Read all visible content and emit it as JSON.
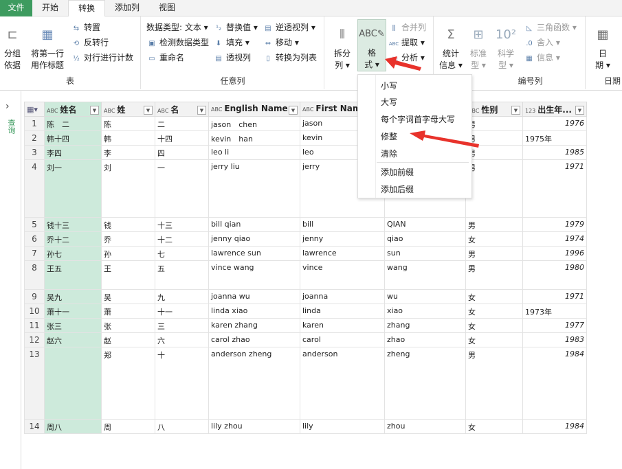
{
  "tabs": [
    "文件",
    "开始",
    "转换",
    "添加列",
    "视图"
  ],
  "ribbon": {
    "table_group": {
      "label": "表",
      "group_by": "分组\n依据",
      "use_first_row": "将第一行\n用作标题",
      "transpose": "转置",
      "reverse_rows": "反转行",
      "count_rows": "对行进行计数"
    },
    "any_column_group": {
      "label": "任意列",
      "data_type": "数据类型: 文本",
      "detect_type": "检测数据类型",
      "rename": "重命名",
      "replace_values": "替换值",
      "fill": "填充",
      "pivot": "透视列",
      "unpivot": "逆透视列",
      "move": "移动",
      "to_list": "转换为列表"
    },
    "text_group": {
      "split": "拆分\n列",
      "format": "格\n式",
      "merge": "合并列",
      "extract": "提取",
      "parse": "分析"
    },
    "number_group": {
      "label": "编号列",
      "stats": "统计\n信息",
      "standard": "标准\n型",
      "scientific": "科学\n型",
      "trig": "三角函数",
      "round": "舍入",
      "info": "信息"
    },
    "date_group": {
      "label": "日期",
      "date": "日\n期"
    }
  },
  "sidebar": {
    "label": "查询"
  },
  "format_menu": [
    "小写",
    "大写",
    "每个字词首字母大写",
    "修整",
    "清除",
    "添加前缀",
    "添加后缀"
  ],
  "table": {
    "columns": [
      {
        "type": "ABC",
        "name": "姓名"
      },
      {
        "type": "ABC",
        "name": "姓"
      },
      {
        "type": "ABC",
        "name": "名"
      },
      {
        "type": "ABC",
        "name": "English Name"
      },
      {
        "type": "ABC",
        "name": "First Name"
      },
      {
        "type": "",
        "name": ""
      },
      {
        "type": "ABC",
        "name": "性别"
      },
      {
        "type": "ABC123",
        "name": "出生年..."
      }
    ],
    "rows": [
      [
        "1",
        "陈　二",
        "陈",
        "二",
        "jason　chen",
        "jason",
        "",
        "男",
        1976
      ],
      [
        "2",
        "韩十四",
        "韩",
        "十四",
        "kevin　han",
        "kevin",
        "",
        "男",
        "1975年"
      ],
      [
        "3",
        "李四",
        "李",
        "四",
        "leo li",
        "leo",
        "",
        "男",
        1985
      ],
      [
        "4",
        "刘一",
        "刘",
        "一",
        "jerry liu",
        "jerry",
        "",
        "男",
        1971
      ],
      [
        "5",
        "钱十三",
        "钱",
        "十三",
        "bill qian",
        "bill",
        "QIAN",
        "男",
        1979
      ],
      [
        "6",
        "乔十二",
        "乔",
        "十二",
        "jenny qiao",
        "jenny",
        "qiao",
        "女",
        1974
      ],
      [
        "7",
        "孙七",
        "孙",
        "七",
        "lawrence sun",
        "lawrence",
        "sun",
        "男",
        1996
      ],
      [
        "8",
        "王五",
        "王",
        "五",
        "vince wang",
        "vince",
        "wang",
        "男",
        1980
      ],
      [
        "9",
        "吴九",
        "吴",
        "九",
        "joanna wu",
        "joanna",
        "wu",
        "女",
        1971
      ],
      [
        "10",
        "萧十一",
        "萧",
        "十一",
        "linda xiao",
        "linda",
        "xiao",
        "女",
        "1973年"
      ],
      [
        "11",
        "张三",
        "张",
        "三",
        "karen zhang",
        "karen",
        "zhang",
        "女",
        1977
      ],
      [
        "12",
        "赵六",
        "赵",
        "六",
        "carol zhao",
        "carol",
        "zhao",
        "女",
        1983
      ],
      [
        "13",
        "",
        "郑",
        "十",
        "anderson zheng",
        "anderson",
        "zheng",
        "男",
        1984
      ],
      [
        "14",
        "周八",
        "周",
        "八",
        "lily zhou",
        "lily",
        "zhou",
        "女",
        1984
      ]
    ]
  },
  "colors": {
    "accent": "#3d9b5f",
    "selected_column": "#cdeadb",
    "arrow": "#e8322b"
  }
}
